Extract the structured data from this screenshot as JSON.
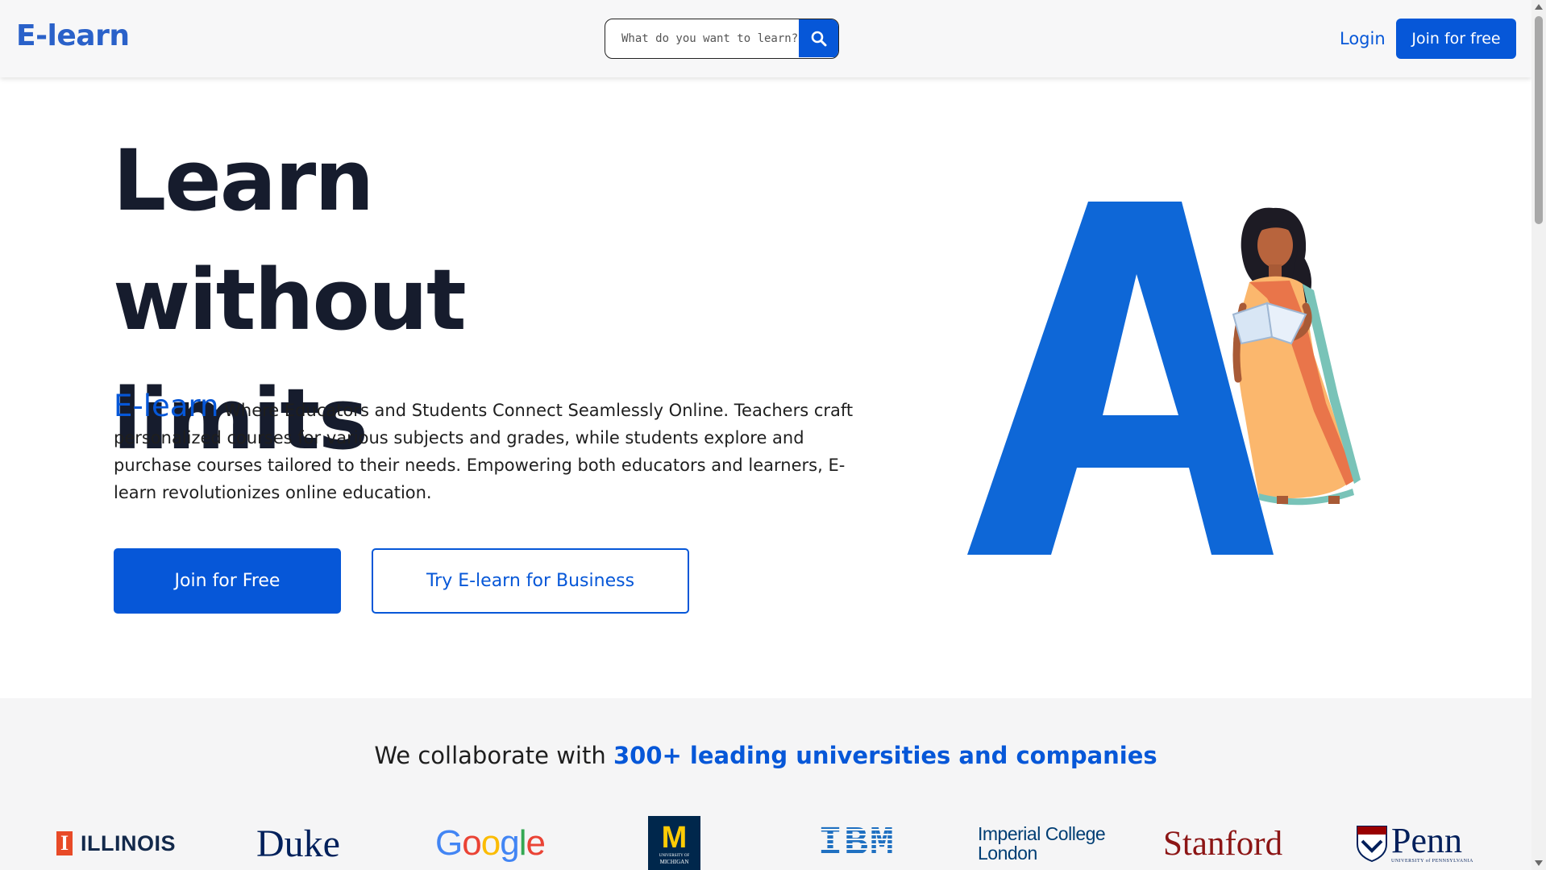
{
  "header": {
    "logo": "E-learn",
    "search_placeholder": "What do you want to learn?",
    "login_label": "Login",
    "join_label": "Join for free"
  },
  "hero": {
    "title_line1": "Learn without",
    "title_line2": "limits",
    "brand": "E-learn",
    "description": " Where Educators and Students Connect Seamlessly Online. Teachers craft personalized courses for various subjects and grades, while students explore and purchase courses tailored to their needs. Empowering both educators and learners, E-learn revolutionizes online education.",
    "primary_button": "Join for Free",
    "secondary_button": "Try E-learn for Business",
    "illustration_letter": "A"
  },
  "partners": {
    "heading_prefix": "We collaborate with ",
    "heading_highlight": "300+ leading universities and companies",
    "logos": {
      "illinois": "ILLINOIS",
      "illinois_mark": "I",
      "duke": "Duke",
      "google": [
        "G",
        "o",
        "o",
        "g",
        "l",
        "e"
      ],
      "michigan_mark": "M",
      "michigan_text1": "UNIVERSITY OF",
      "michigan_text2": "MICHIGAN",
      "ibm": "IBM",
      "imperial_line1": "Imperial College",
      "imperial_line2": "London",
      "stanford": "Stanford",
      "penn": "Penn",
      "penn_sub": "UNIVERSITY of PENNSYLVANIA"
    }
  },
  "colors": {
    "accent": "#0657d8",
    "logo_blue": "#2a61c9",
    "illinois_orange": "#e84a27",
    "duke_navy": "#00205b",
    "michigan_blue": "#00274c",
    "michigan_maize": "#ffcb05",
    "ibm_blue": "#1f70c1",
    "imperial_navy": "#003e74",
    "stanford_red": "#8c1515",
    "penn_navy": "#011f5b"
  },
  "icons": {
    "search": "search-icon"
  }
}
